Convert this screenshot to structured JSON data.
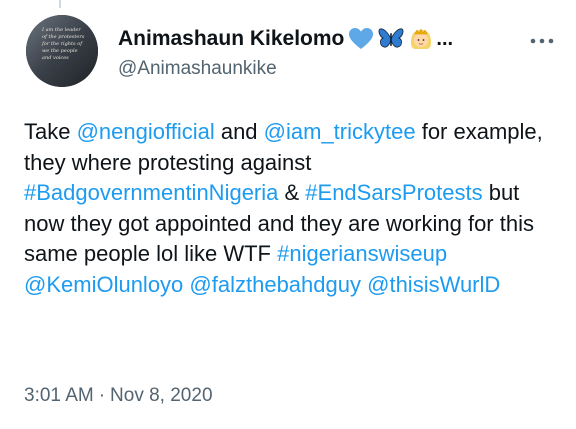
{
  "author": {
    "display_name": "Animashaun Kikelomo",
    "ellipsis": "...",
    "handle": "@Animashaunkike",
    "emojis": [
      "blue-heart-icon",
      "butterfly-icon",
      "woman-with-crown-icon"
    ],
    "avatar_text": [
      "I am the leader",
      "of the protesters",
      "for the rights of",
      "we the people",
      "and voices"
    ]
  },
  "menu": {
    "icon": "more-horizontal-icon"
  },
  "tweet": {
    "segments": [
      {
        "text": "Take ",
        "type": "text"
      },
      {
        "text": "@nengiofficial",
        "type": "mention"
      },
      {
        "text": " and  ",
        "type": "text"
      },
      {
        "text": "@iam_trickytee",
        "type": "mention"
      },
      {
        "text": " for example, they where protesting against ",
        "type": "text"
      },
      {
        "text": "#BadgovernmentinNigeria",
        "type": "hashtag"
      },
      {
        "text": " & ",
        "type": "text"
      },
      {
        "text": "#EndSarsProtests",
        "type": "hashtag"
      },
      {
        "text": " but now they got appointed and they are working for this same people lol like WTF  ",
        "type": "text"
      },
      {
        "text": "#nigerianswiseup",
        "type": "hashtag"
      },
      {
        "text": " ",
        "type": "text"
      },
      {
        "text": "@KemiOlunloyo",
        "type": "mention"
      },
      {
        "text": " ",
        "type": "text"
      },
      {
        "text": "@falzthebahdguy",
        "type": "mention"
      },
      {
        "text": " ",
        "type": "text"
      },
      {
        "text": "@thisisWurlD",
        "type": "mention"
      }
    ]
  },
  "meta": {
    "time": "3:01 AM",
    "separator": "·",
    "date": "Nov 8, 2020"
  },
  "colors": {
    "link": "#1d9bf0",
    "text": "#0f1419",
    "secondary": "#536471",
    "heart": "#5fa8e8",
    "butterfly": "#2f7bd0"
  }
}
